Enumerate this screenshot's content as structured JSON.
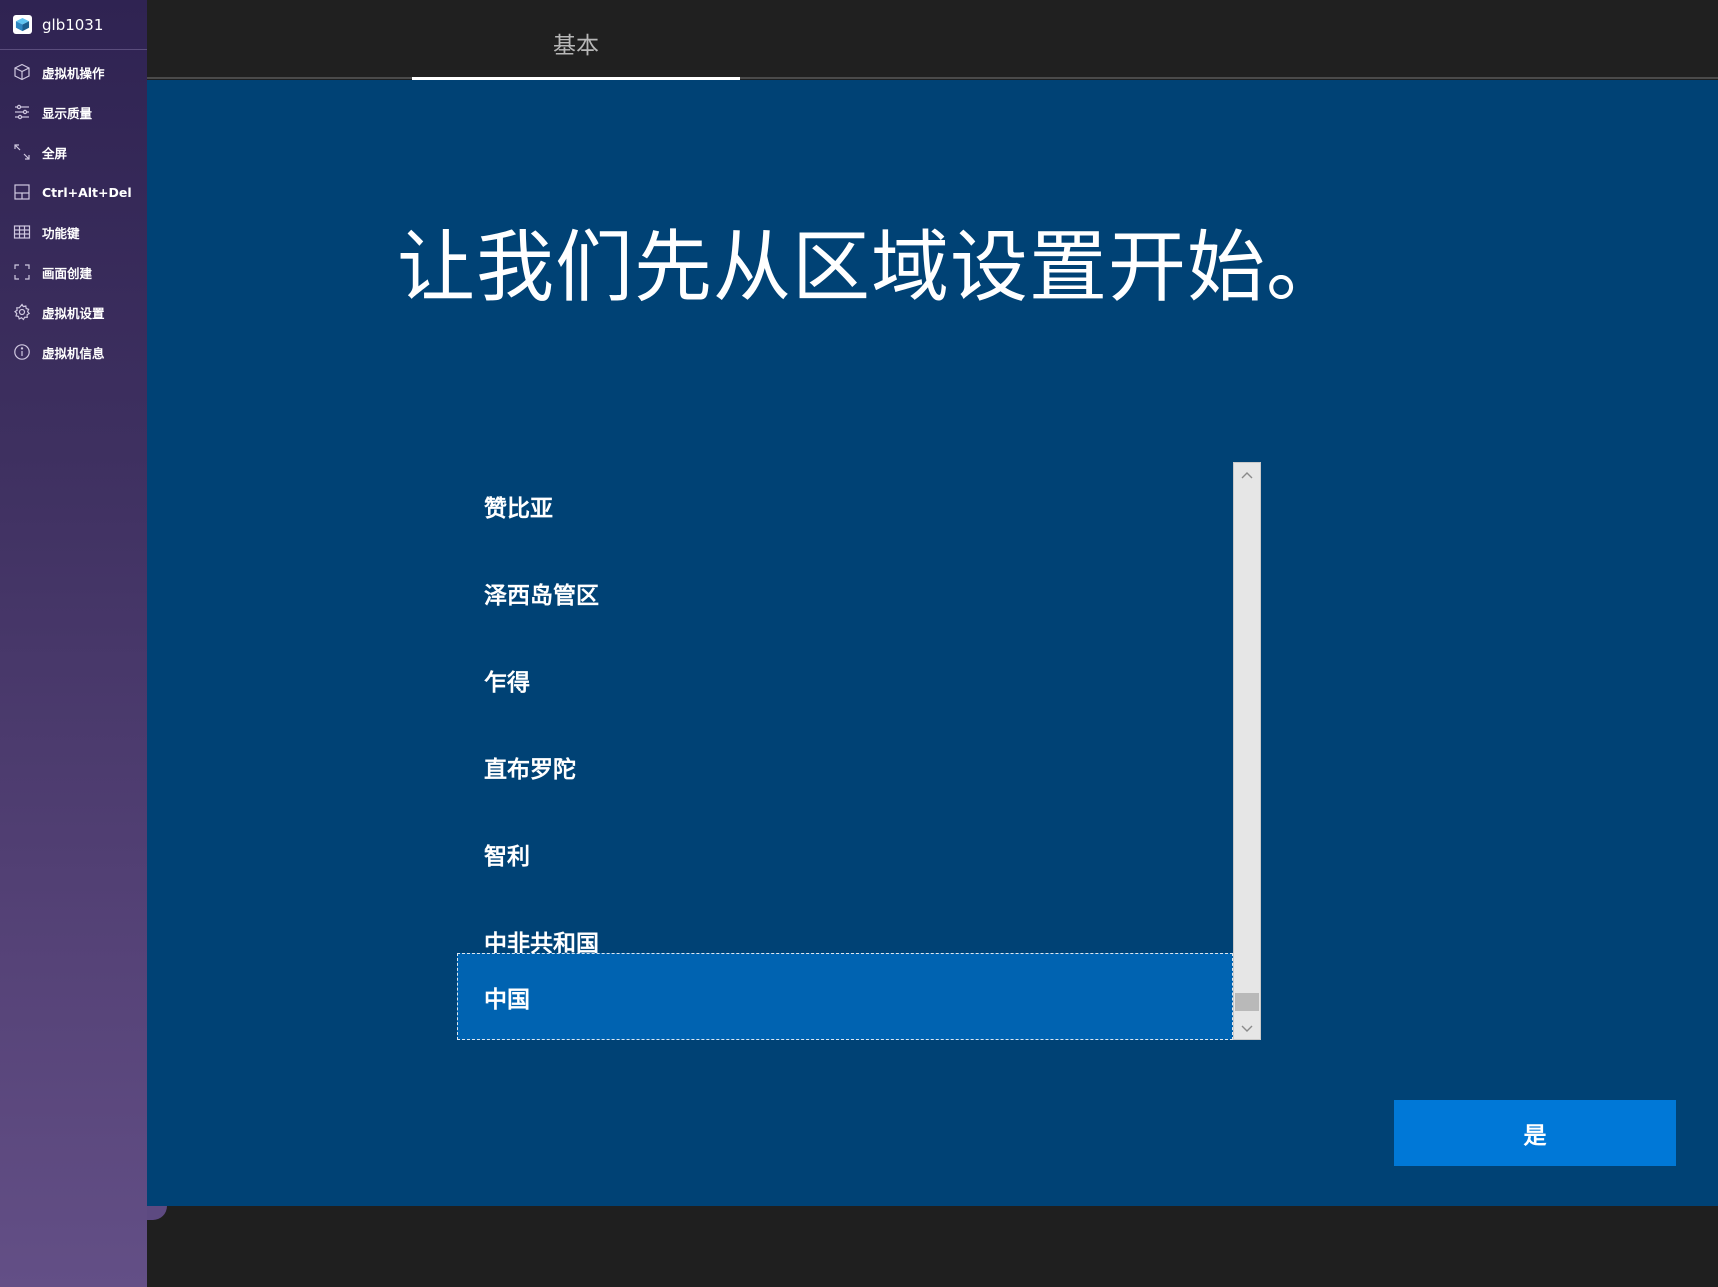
{
  "sidebar": {
    "vm_name": "glb1031",
    "items": [
      {
        "label": "虚拟机操作",
        "icon": "cube-icon"
      },
      {
        "label": "显示质量",
        "icon": "sliders-icon"
      },
      {
        "label": "全屏",
        "icon": "expand-icon"
      },
      {
        "label": "Ctrl+Alt+Del",
        "icon": "keyboard-combo-icon"
      },
      {
        "label": "功能键",
        "icon": "grid-icon"
      },
      {
        "label": "画面创建",
        "icon": "screenshot-frame-icon"
      },
      {
        "label": "虚拟机设置",
        "icon": "gear-icon"
      },
      {
        "label": "虚拟机信息",
        "icon": "info-icon"
      }
    ]
  },
  "topbar": {
    "tabs": [
      {
        "label": "基本",
        "active": true
      }
    ]
  },
  "oobe": {
    "heading": "让我们先从区域设置开始。",
    "regions": [
      "赞比亚",
      "泽西岛管区",
      "乍得",
      "直布罗陀",
      "智利",
      "中非共和国",
      "中国"
    ],
    "selected_region": "中国",
    "confirm_label": "是"
  },
  "colors": {
    "oobe_background": "#004275",
    "selected_item": "#0063b1",
    "primary_button": "#0078d7",
    "sidebar_top": "#2f2352",
    "sidebar_bottom": "#634f86"
  }
}
